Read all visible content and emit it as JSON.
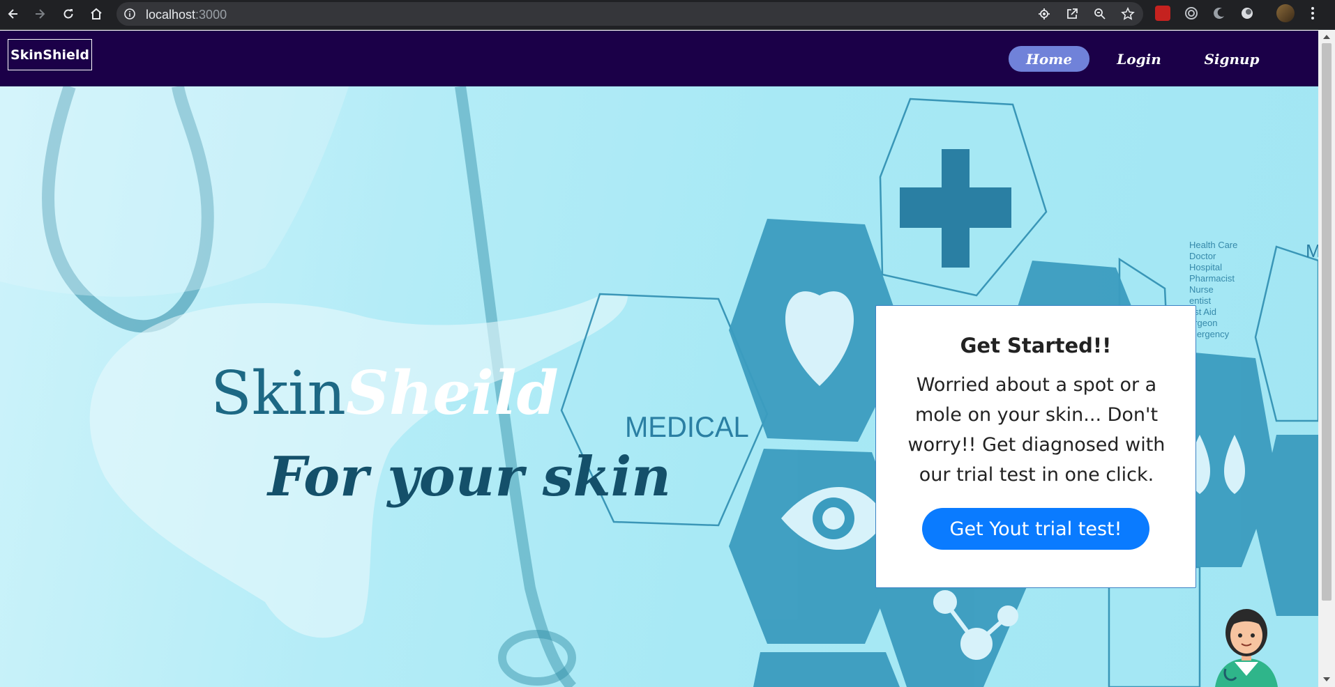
{
  "browser": {
    "url_host": "localhost",
    "url_port": ":3000",
    "back_icon": "arrow-left-icon",
    "forward_icon": "arrow-right-icon",
    "reload_icon": "reload-icon",
    "home_icon": "home-icon"
  },
  "navbar": {
    "brand": "SkinShield",
    "links": [
      {
        "label": "Home",
        "active": true
      },
      {
        "label": "Login",
        "active": false
      },
      {
        "label": "Signup",
        "active": false
      }
    ]
  },
  "hero": {
    "title_part1": "Skin",
    "title_part2": "Sheild",
    "tagline": "For your skin",
    "medical_label": "MEDICAL",
    "side_list": [
      "Health Care",
      "Doctor",
      "Hospital",
      "Pharmacist",
      "Nurse",
      "entist",
      "irst Aid",
      "urgeon",
      "mergency"
    ],
    "side_letter": "M"
  },
  "card": {
    "title": "Get Started!!",
    "body": "Worried about a spot or a mole on your skin... Don't worry!! Get diagnosed with our trial test in one click.",
    "button": "Get Yout trial test!"
  },
  "colors": {
    "navbar_bg": "#1b0048",
    "active_pill": "#7082d9",
    "cta_blue": "#0a7bff",
    "hex_fill": "#3b9cbf"
  }
}
